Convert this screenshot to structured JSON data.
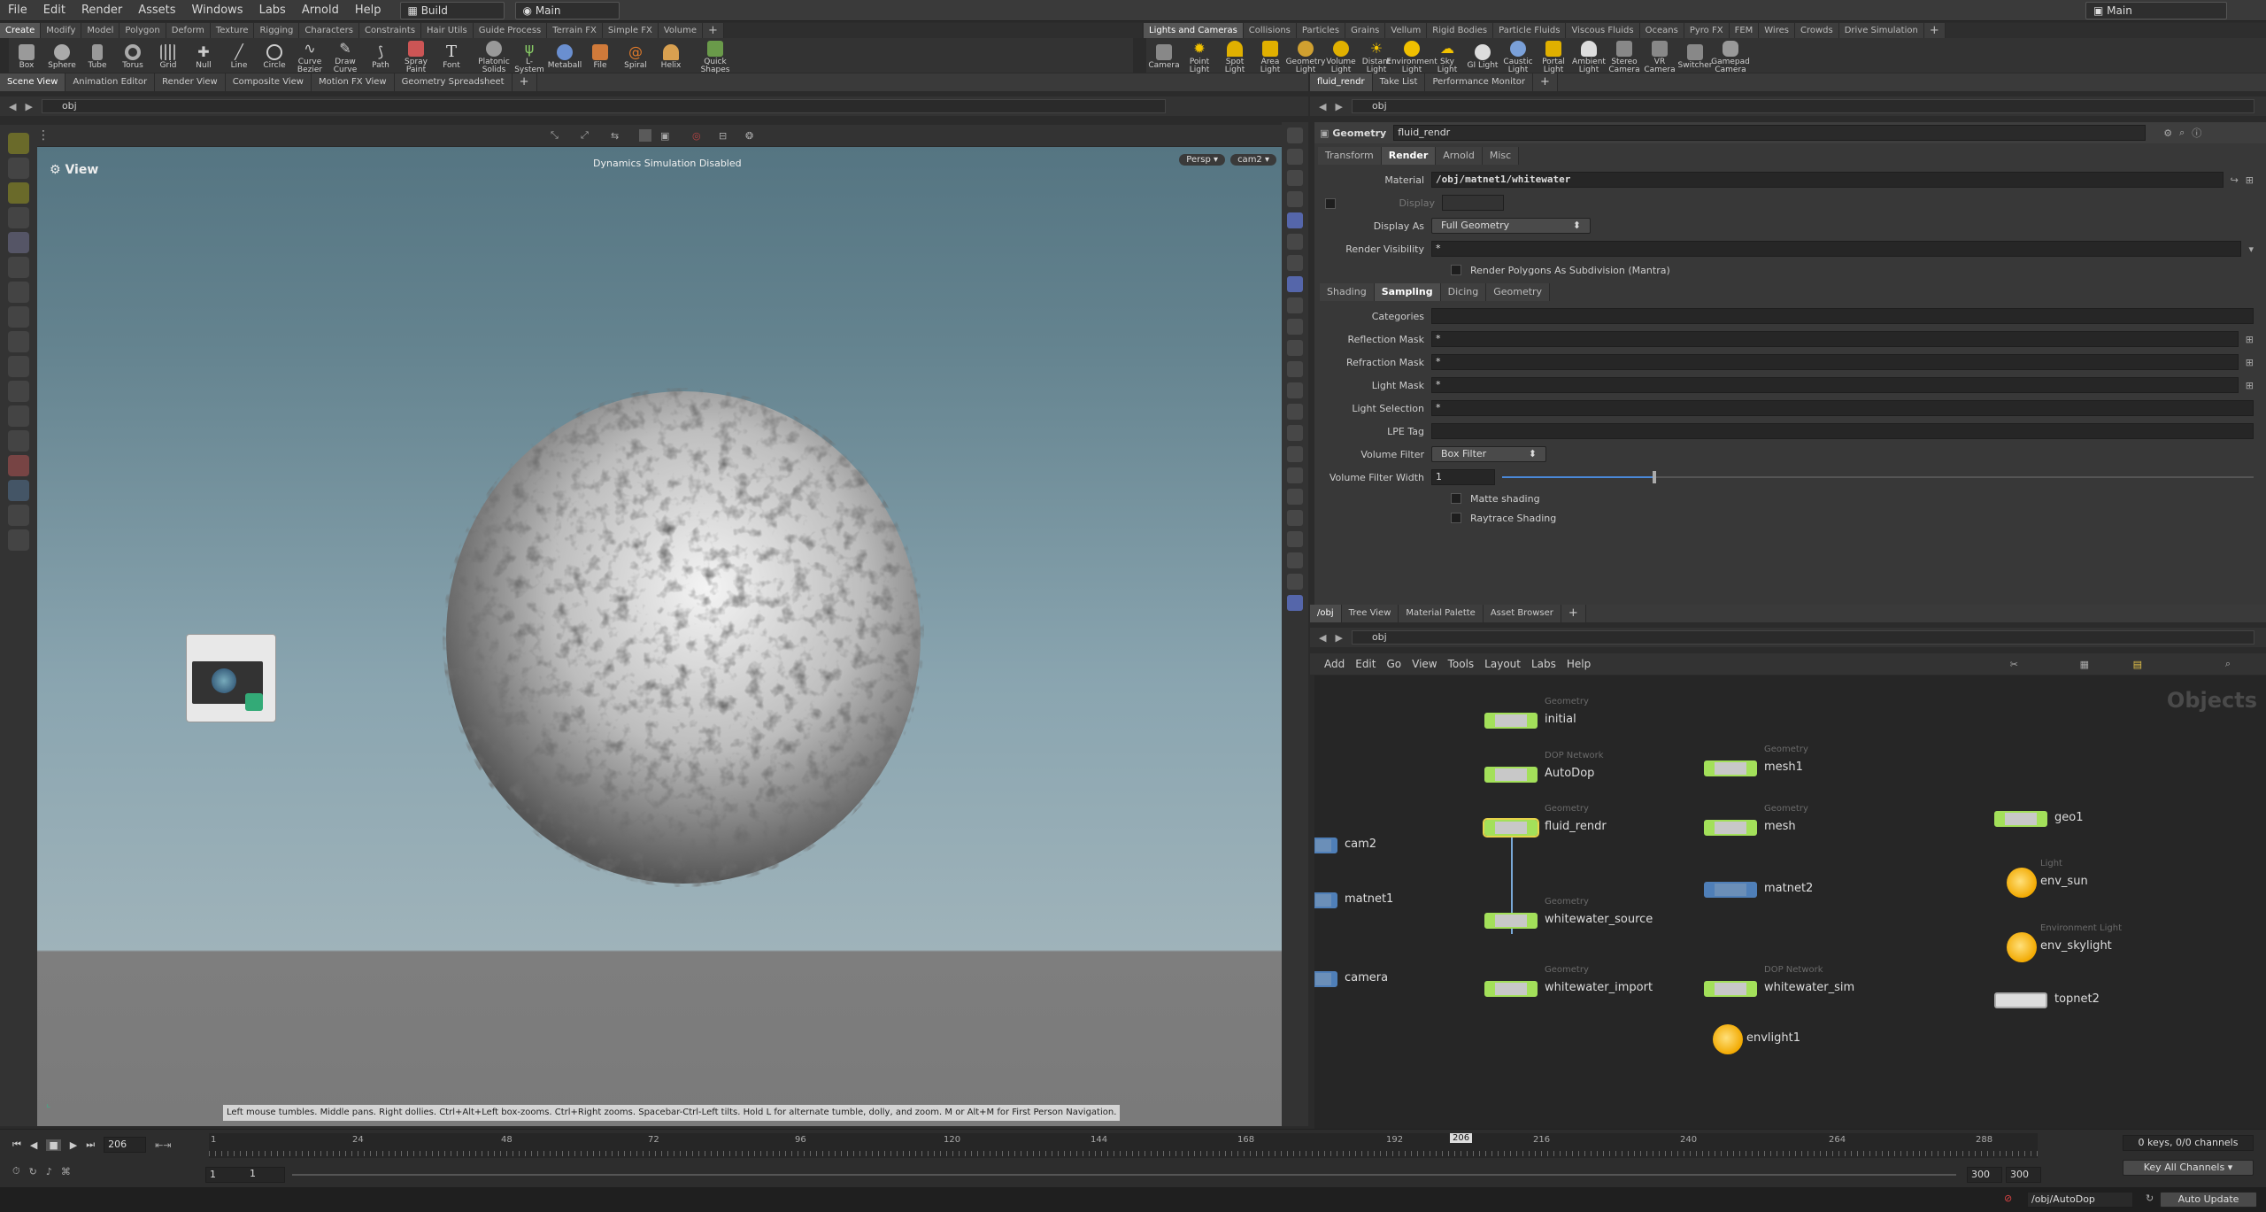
{
  "menubar": {
    "items": [
      "File",
      "Edit",
      "Render",
      "Assets",
      "Windows",
      "Labs",
      "Arnold",
      "Help"
    ],
    "desktop": "Build",
    "context": "Main",
    "right_context": "Main"
  },
  "shelf_left": {
    "tabs": [
      "Create",
      "Modify",
      "Model",
      "Polygon",
      "Deform",
      "Texture",
      "Rigging",
      "Characters",
      "Constraints",
      "Hair Utils",
      "Guide Process",
      "Terrain FX",
      "Simple FX",
      "Volume"
    ],
    "tools": [
      "Box",
      "Sphere",
      "Tube",
      "Torus",
      "Grid",
      "Null",
      "Line",
      "Circle",
      "Curve Bezier",
      "Draw Curve",
      "Path",
      "Spray Paint",
      "Font",
      "Platonic Solids",
      "L-System",
      "Metaball",
      "File",
      "Spiral",
      "Helix",
      "Quick Shapes"
    ]
  },
  "shelf_right": {
    "tabs": [
      "Lights and Cameras",
      "Collisions",
      "Particles",
      "Grains",
      "Vellum",
      "Rigid Bodies",
      "Particle Fluids",
      "Viscous Fluids",
      "Oceans",
      "Pyro FX",
      "FEM",
      "Wires",
      "Crowds",
      "Drive Simulation"
    ],
    "tools": [
      "Camera",
      "Point Light",
      "Spot Light",
      "Area Light",
      "Geometry Light",
      "Volume Light",
      "Distant Light",
      "Environment Light",
      "Sky Light",
      "GI Light",
      "Caustic Light",
      "Portal Light",
      "Ambient Light",
      "Stereo Camera",
      "VR Camera",
      "Switcher",
      "Gamepad Camera"
    ]
  },
  "left_panel": {
    "tabs": [
      "Scene View",
      "Animation Editor",
      "Render View",
      "Composite View",
      "Motion FX View",
      "Geometry Spreadsheet"
    ],
    "path": "obj",
    "view_label": "View",
    "overlay_message": "Dynamics Simulation Disabled",
    "persp": "Persp",
    "camera": "cam2",
    "help_text": "Left mouse tumbles. Middle pans. Right dollies. Ctrl+Alt+Left box-zooms. Ctrl+Right zooms. Spacebar-Ctrl-Left tilts. Hold L for alternate tumble, dolly, and zoom. M or Alt+M for First Person Navigation."
  },
  "right_top": {
    "tabs": [
      "fluid_rendr",
      "Take List",
      "Performance Monitor"
    ],
    "path": "obj",
    "node_type": "Geometry",
    "node_name": "fluid_rendr",
    "param_tabs": [
      "Transform",
      "Render",
      "Arnold",
      "Misc"
    ],
    "material_label": "Material",
    "material_value": "/obj/matnet1/whitewater",
    "display_label": "Display",
    "display_as_label": "Display As",
    "display_as_value": "Full Geometry",
    "render_visibility_label": "Render Visibility",
    "render_visibility_value": "*",
    "render_polygons_label": "Render Polygons As Subdivision (Mantra)",
    "sub_tabs": [
      "Shading",
      "Sampling",
      "Dicing",
      "Geometry"
    ],
    "categories_label": "Categories",
    "reflection_mask_label": "Reflection Mask",
    "reflection_mask_value": "*",
    "refraction_mask_label": "Refraction Mask",
    "refraction_mask_value": "*",
    "light_mask_label": "Light Mask",
    "light_mask_value": "*",
    "light_selection_label": "Light Selection",
    "light_selection_value": "*",
    "lpe_tag_label": "LPE Tag",
    "volume_filter_label": "Volume Filter",
    "volume_filter_value": "Box Filter",
    "volume_filter_width_label": "Volume Filter Width",
    "volume_filter_width_value": "1",
    "matte_label": "Matte shading",
    "raytrace_label": "Raytrace Shading"
  },
  "network": {
    "tabs": [
      "/obj",
      "Tree View",
      "Material Palette",
      "Asset Browser"
    ],
    "path": "obj",
    "menu": [
      "Add",
      "Edit",
      "Go",
      "View",
      "Tools",
      "Layout",
      "Labs",
      "Help"
    ],
    "context_label": "Objects",
    "nodes": {
      "initial": {
        "type": "Geometry",
        "name": "initial"
      },
      "autodop": {
        "type": "DOP Network",
        "name": "AutoDop"
      },
      "fluid_rendr": {
        "type": "Geometry",
        "name": "fluid_rendr"
      },
      "whitewater_source": {
        "type": "Geometry",
        "name": "whitewater_source"
      },
      "whitewater_import": {
        "type": "Geometry",
        "name": "whitewater_import"
      },
      "mesh1": {
        "type": "Geometry",
        "name": "mesh1"
      },
      "mesh": {
        "type": "Geometry",
        "name": "mesh"
      },
      "matnet2": {
        "name": "matnet2"
      },
      "whitewater_sim": {
        "type": "DOP Network",
        "name": "whitewater_sim"
      },
      "envlight1": {
        "name": "envlight1"
      },
      "cam2": {
        "name": "cam2"
      },
      "matnet1": {
        "name": "matnet1"
      },
      "camera": {
        "name": "camera"
      },
      "geo1": {
        "name": "geo1"
      },
      "env_sun": {
        "type": "Light",
        "name": "env_sun"
      },
      "env_skylight": {
        "type": "Environment Light",
        "name": "env_skylight"
      },
      "topnet2": {
        "name": "topnet2"
      }
    }
  },
  "timeline": {
    "current_frame": "206",
    "ticks": [
      "1",
      "24",
      "48",
      "72",
      "96",
      "120",
      "144",
      "168",
      "192",
      "216",
      "240",
      "264",
      "288"
    ],
    "marker": "206",
    "start": "1",
    "start2": "1",
    "end": "300",
    "end2": "300",
    "keys_info": "0 keys, 0/0 channels",
    "key_all": "Key All Channels"
  },
  "statusbar": {
    "path": "/obj/AutoDop",
    "auto_update": "Auto Update"
  }
}
